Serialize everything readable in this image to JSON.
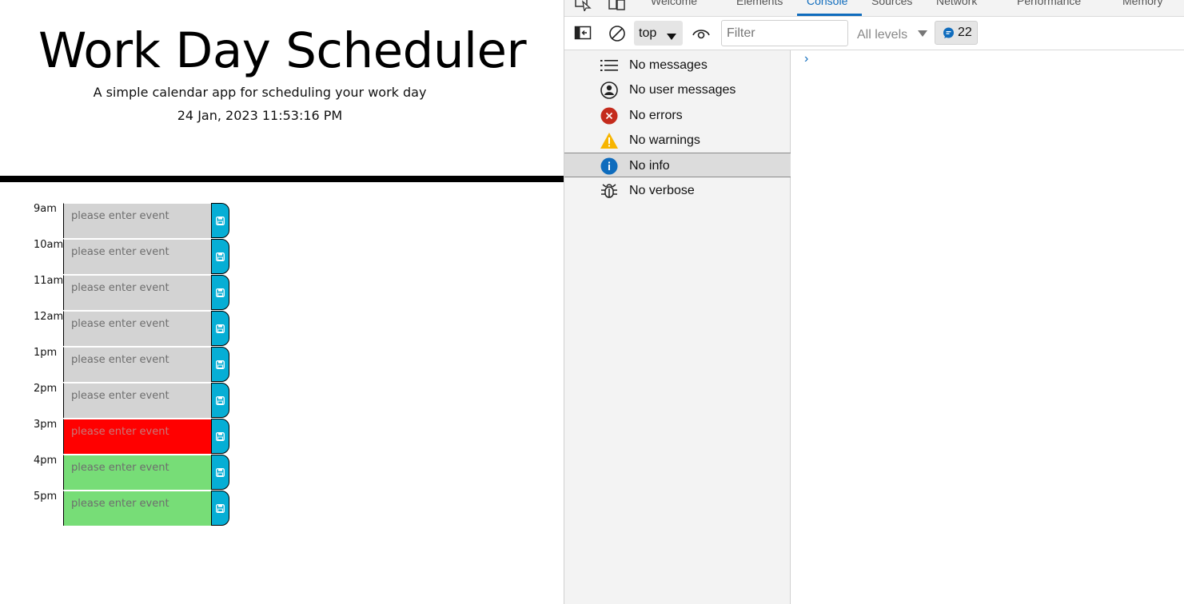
{
  "app": {
    "title": "Work Day Scheduler",
    "subtitle": "A simple calendar app for scheduling your work day",
    "datetime": "24 Jan, 2023 11:53:16 PM",
    "event_placeholder": "please enter event",
    "colors": {
      "past": "#d3d3d3",
      "present": "#ff0000",
      "future": "#77dd77",
      "save": "#06aed5"
    },
    "hours": [
      {
        "label": "9am",
        "state": "past"
      },
      {
        "label": "10am",
        "state": "past"
      },
      {
        "label": "11am",
        "state": "past"
      },
      {
        "label": "12am",
        "state": "past"
      },
      {
        "label": "1pm",
        "state": "past"
      },
      {
        "label": "2pm",
        "state": "past"
      },
      {
        "label": "3pm",
        "state": "present"
      },
      {
        "label": "4pm",
        "state": "future"
      },
      {
        "label": "5pm",
        "state": "future"
      }
    ]
  },
  "devtools": {
    "tabs": [
      "Welcome",
      "Elements",
      "Console",
      "Sources",
      "Network",
      "Performance",
      "Memory"
    ],
    "active_tab": "Console",
    "context": "top",
    "filter_placeholder": "Filter",
    "levels": "All levels",
    "issues_count": "22",
    "sidebar": [
      {
        "label": "No messages",
        "icon": "list-icon"
      },
      {
        "label": "No user messages",
        "icon": "user-icon"
      },
      {
        "label": "No errors",
        "icon": "error-icon"
      },
      {
        "label": "No warnings",
        "icon": "warning-icon"
      },
      {
        "label": "No info",
        "icon": "info-icon"
      },
      {
        "label": "No verbose",
        "icon": "bug-icon"
      }
    ],
    "prompt": "›"
  }
}
